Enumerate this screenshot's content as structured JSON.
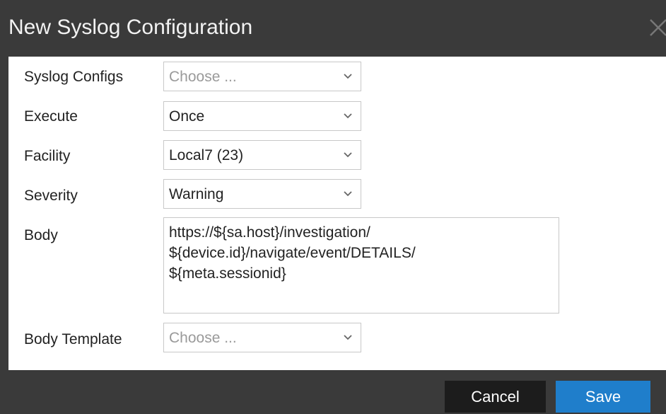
{
  "dialog": {
    "title": "New Syslog Configuration"
  },
  "form": {
    "syslog_configs": {
      "label": "Syslog Configs",
      "placeholder": "Choose ..."
    },
    "execute": {
      "label": "Execute",
      "value": "Once"
    },
    "facility": {
      "label": "Facility",
      "value": "Local7 (23)"
    },
    "severity": {
      "label": "Severity",
      "value": "Warning"
    },
    "body": {
      "label": "Body",
      "lines": [
        "https://${sa.host}/investigation/",
        "${device.id}/navigate/event/DETAILS/",
        "${meta.sessionid}"
      ]
    },
    "body_template": {
      "label": "Body Template",
      "placeholder": "Choose ..."
    }
  },
  "footer": {
    "cancel_label": "Cancel",
    "save_label": "Save"
  },
  "colors": {
    "titlebar": "#3a3a3a",
    "cancel_button": "#1c1c1c",
    "save_button": "#1f7ecb"
  },
  "icons": {
    "close": "close-icon",
    "dropdown": "chevron-down-icon"
  }
}
